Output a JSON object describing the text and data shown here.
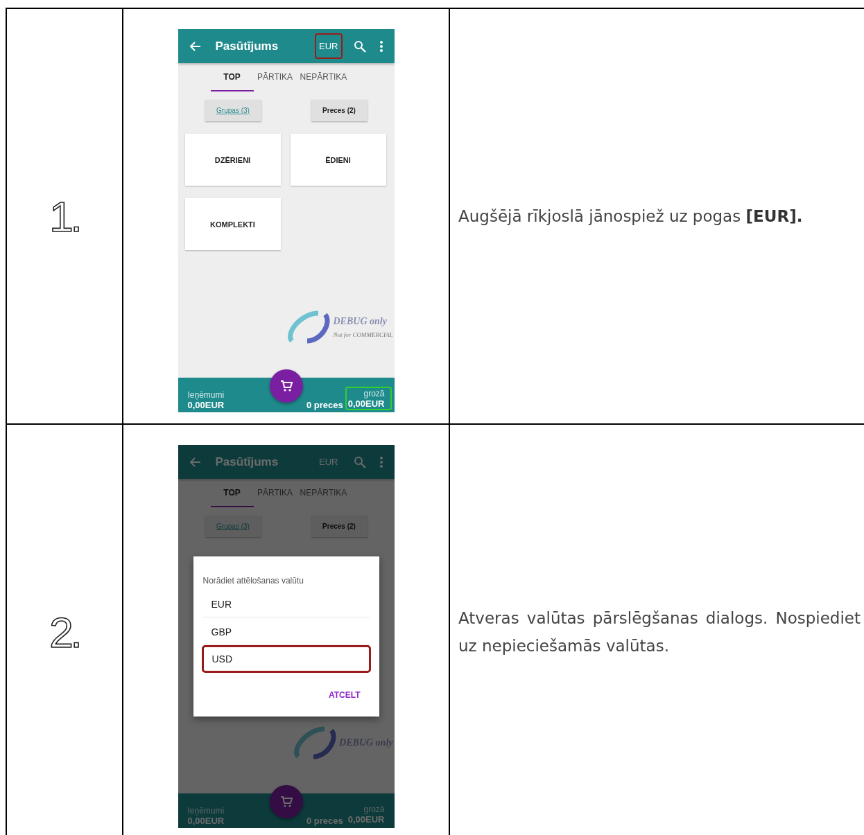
{
  "steps": [
    {
      "number": "1.",
      "description": "Augšējā rīkjoslā jānospiež uz pogas **[EUR].**",
      "justified": false,
      "screen": {
        "appbar": {
          "title": "Pasūtījums",
          "currency": "EUR",
          "currency_highlighted": true
        },
        "tabs": [
          {
            "label": "TOP",
            "selected": true
          },
          {
            "label": "PĀRTIKA",
            "selected": false
          },
          {
            "label": "NEPĀRTIKA",
            "selected": false
          }
        ],
        "filters": [
          {
            "label": "Grupas (3)",
            "selected": true
          },
          {
            "label": "Preces (2)",
            "selected": false
          }
        ],
        "tiles": [
          {
            "label": "DZĒRIENI"
          },
          {
            "label": "ĒDIENI"
          },
          {
            "label": "KOMPLEKTI"
          }
        ],
        "watermark": {
          "title": "DEBUG only",
          "subtitle": "Not for COMMERCIAL"
        },
        "footer": {
          "left_label": "Ieņēmumi",
          "left_value": "0,00EUR",
          "right_label": "grozā",
          "items": "0 preces",
          "right_value": "0,00EUR",
          "cart_highlighted": true
        }
      }
    },
    {
      "number": "2.",
      "description": "Atveras valūtas pārslēgšanas dialogs. Nospiediet uz nepieciešamās valūtas.",
      "justified": true,
      "screen": {
        "appbar": {
          "title": "Pasūtījums",
          "currency": "EUR"
        },
        "tabs": [
          {
            "label": "TOP",
            "selected": true
          },
          {
            "label": "PĀRTIKA",
            "selected": false
          },
          {
            "label": "NEPĀRTIKA",
            "selected": false
          }
        ],
        "filters": [
          {
            "label": "Grupas (3)",
            "selected": true
          },
          {
            "label": "Preces (2)",
            "selected": false
          }
        ],
        "watermark": {
          "title": "DEBUG only"
        },
        "footer": {
          "left_label": "Ieņēmumi",
          "left_value": "0,00EUR",
          "right_label": "grozā",
          "items": "0 preces",
          "right_value": "0,00EUR"
        },
        "dialog": {
          "title": "Norādiet attēlošanas valūtu",
          "options": [
            {
              "label": "EUR",
              "highlighted": false
            },
            {
              "label": "GBP",
              "highlighted": false
            },
            {
              "label": "USD",
              "highlighted": true
            }
          ],
          "cancel": "ATCELT"
        }
      }
    }
  ]
}
